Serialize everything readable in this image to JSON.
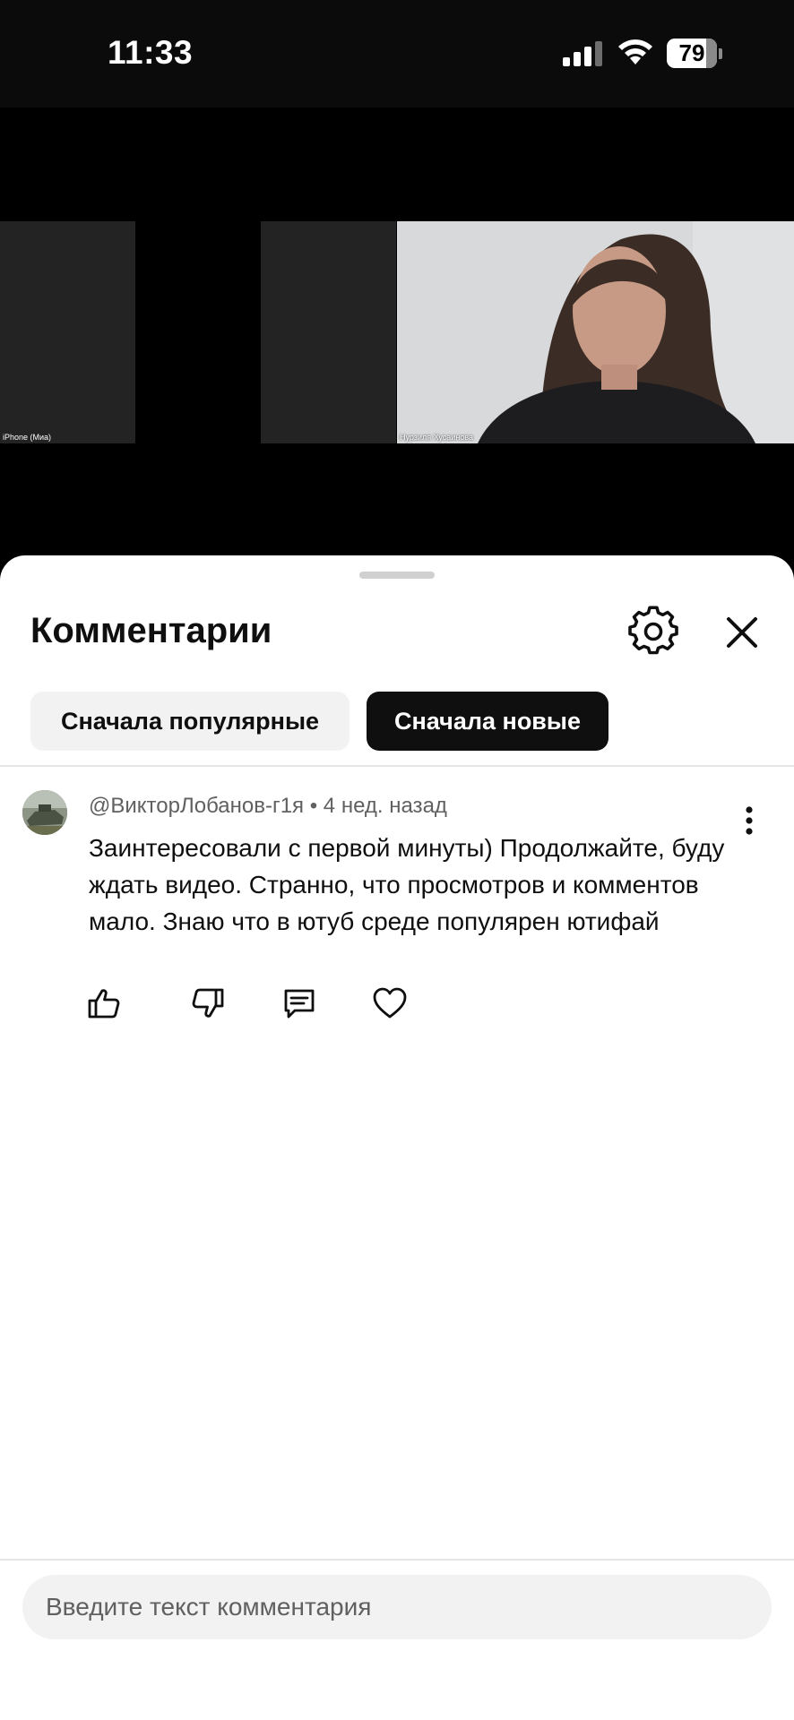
{
  "status_bar": {
    "time": "11:33",
    "battery_level": "79",
    "battery_fraction": 0.79,
    "icons": [
      "cellular-signal-icon",
      "wifi-icon",
      "battery-icon"
    ]
  },
  "video": {
    "participants": [
      {
        "label": "iPhone (Миа)"
      },
      {
        "label": ""
      },
      {
        "label": "Нурзиля Хусаинова"
      }
    ]
  },
  "comments_panel": {
    "title": "Комментарии",
    "icons": {
      "settings": "gear-icon",
      "close": "close-icon"
    },
    "sort_options": [
      {
        "label": "Сначала популярные",
        "selected": false
      },
      {
        "label": "Сначала новые",
        "selected": true
      }
    ]
  },
  "comments": [
    {
      "author": "@ВикторЛобанов-г1я",
      "separator": "•",
      "time_ago": "4 нед. назад",
      "meta": "@ВикторЛобанов-г1я • 4 нед. назад",
      "text": "Заинтересовали с первой минуты) Продолжайте, буду ждать видео. Странно, что просмотров и комментов мало. Знаю что в ютуб среде популярен ютифай",
      "actions": [
        "thumbs-up-icon",
        "thumbs-down-icon",
        "reply-icon",
        "heart-icon"
      ]
    }
  ],
  "input": {
    "placeholder": "Введите текст комментария",
    "value": ""
  },
  "colors": {
    "background_dark": "#000000",
    "sheet": "#ffffff",
    "chip_selected": "#0f0f0f",
    "chip_default": "#f2f2f2",
    "secondary_text": "#606060"
  }
}
